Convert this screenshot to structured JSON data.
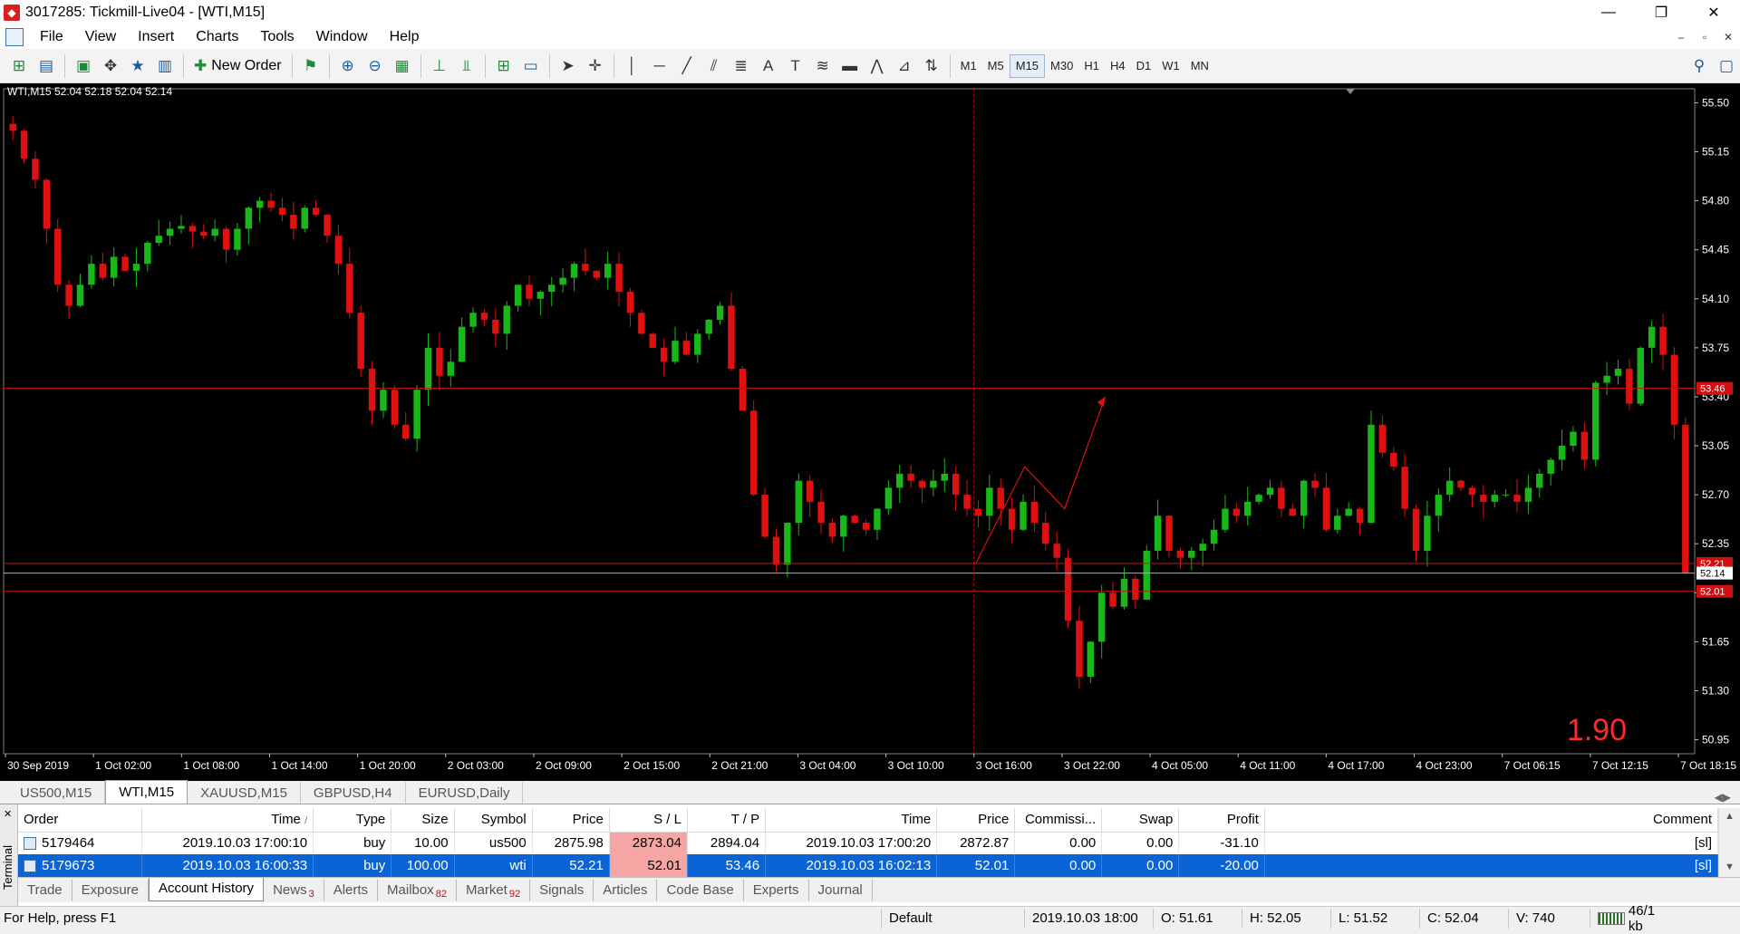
{
  "window": {
    "title": "3017285: Tickmill-Live04 - [WTI,M15]",
    "logo_glyph": "◆",
    "buttons": {
      "minimize": "—",
      "restore": "❐",
      "close": "✕"
    }
  },
  "menu": {
    "items": [
      "File",
      "View",
      "Insert",
      "Charts",
      "Tools",
      "Window",
      "Help"
    ],
    "mdi_buttons": [
      "–",
      "▫",
      "✕"
    ]
  },
  "toolbar": {
    "new_order_label": "New Order",
    "timeframes": [
      "M1",
      "M5",
      "M15",
      "M30",
      "H1",
      "H4",
      "D1",
      "W1",
      "MN"
    ],
    "active_timeframe": "M15"
  },
  "chart_data": {
    "type": "candlestick",
    "header": "WTI,M15  52.04 52.18 52.04 52.14",
    "y_ticks": [
      "55.50",
      "55.15",
      "54.80",
      "54.45",
      "54.10",
      "53.75",
      "53.40",
      "53.05",
      "52.70",
      "52.35",
      "52.00",
      "51.65",
      "51.30",
      "50.95"
    ],
    "x_ticks": [
      "30 Sep 2019",
      "1 Oct 02:00",
      "1 Oct 08:00",
      "1 Oct 14:00",
      "1 Oct 20:00",
      "2 Oct 03:00",
      "2 Oct 09:00",
      "2 Oct 15:00",
      "2 Oct 21:00",
      "3 Oct 04:00",
      "3 Oct 10:00",
      "3 Oct 16:00",
      "3 Oct 22:00",
      "4 Oct 05:00",
      "4 Oct 11:00",
      "4 Oct 17:00",
      "4 Oct 23:00",
      "7 Oct 06:15",
      "7 Oct 12:15",
      "7 Oct 18:15"
    ],
    "ylim": [
      50.85,
      55.6
    ],
    "levels": [
      {
        "label": "53.46",
        "value": 53.46,
        "color": "#d01010"
      },
      {
        "label": "52.21",
        "value": 52.21,
        "color": "#d01010"
      },
      {
        "label": "52.14",
        "value": 52.14,
        "color": "#b0b0b0"
      },
      {
        "label": "52.01",
        "value": 52.01,
        "color": "#d01010"
      }
    ],
    "close_series": [
      55.3,
      55.1,
      54.95,
      54.6,
      54.2,
      54.05,
      54.2,
      54.35,
      54.25,
      54.4,
      54.3,
      54.35,
      54.5,
      54.55,
      54.6,
      54.62,
      54.58,
      54.55,
      54.6,
      54.45,
      54.6,
      54.75,
      54.8,
      54.75,
      54.7,
      54.6,
      54.75,
      54.7,
      54.55,
      54.35,
      54.0,
      53.6,
      53.3,
      53.45,
      53.2,
      53.1,
      53.45,
      53.75,
      53.55,
      53.65,
      53.9,
      54.0,
      53.95,
      53.85,
      54.05,
      54.2,
      54.1,
      54.15,
      54.2,
      54.25,
      54.35,
      54.3,
      54.25,
      54.35,
      54.15,
      54.0,
      53.85,
      53.75,
      53.65,
      53.8,
      53.7,
      53.85,
      53.95,
      54.05,
      53.6,
      53.3,
      52.7,
      52.4,
      52.2,
      52.5,
      52.8,
      52.65,
      52.5,
      52.4,
      52.55,
      52.5,
      52.45,
      52.6,
      52.75,
      52.85,
      52.8,
      52.75,
      52.8,
      52.85,
      52.7,
      52.6,
      52.55,
      52.75,
      52.6,
      52.45,
      52.65,
      52.5,
      52.35,
      52.25,
      51.8,
      51.4,
      51.65,
      52.0,
      51.9,
      52.1,
      51.95,
      52.3,
      52.55,
      52.3,
      52.25,
      52.3,
      52.35,
      52.45,
      52.6,
      52.55,
      52.65,
      52.7,
      52.75,
      52.6,
      52.55,
      52.8,
      52.75,
      52.45,
      52.55,
      52.6,
      52.5,
      53.2,
      53.0,
      52.9,
      52.6,
      52.3,
      52.55,
      52.7,
      52.8,
      52.75,
      52.7,
      52.65,
      52.7,
      52.7,
      52.65,
      52.75,
      52.85,
      52.95,
      53.05,
      53.15,
      52.95,
      53.5,
      53.55,
      53.6,
      53.35,
      53.75,
      53.9,
      53.7,
      53.2,
      52.14
    ]
  },
  "chart_overlay": {
    "spread": "1.90"
  },
  "chart_tabs": {
    "items": [
      "US500,M15",
      "WTI,M15",
      "XAUUSD,M15",
      "GBPUSD,H4",
      "EURUSD,Daily"
    ],
    "active": "WTI,M15",
    "nav": [
      "◀",
      "▶"
    ]
  },
  "terminal": {
    "side_label": "Terminal",
    "close_glyph": "✕",
    "columns": [
      "Order",
      "Time",
      "Type",
      "Size",
      "Symbol",
      "Price",
      "S / L",
      "T / P",
      "Time",
      "Price",
      "Commissi...",
      "Swap",
      "Profit",
      "Comment"
    ],
    "sort_mark": "/",
    "rows": [
      {
        "order": "5179464",
        "open_time": "2019.10.03 17:00:10",
        "type": "buy",
        "size": "10.00",
        "symbol": "us500",
        "price": "2875.98",
        "sl": "2873.04",
        "tp": "2894.04",
        "close_time": "2019.10.03 17:00:20",
        "close_price": "2872.87",
        "commission": "0.00",
        "swap": "0.00",
        "profit": "-31.10",
        "comment": "[sl]"
      },
      {
        "order": "5179673",
        "open_time": "2019.10.03 16:00:33",
        "type": "buy",
        "size": "100.00",
        "symbol": "wti",
        "price": "52.21",
        "sl": "52.01",
        "tp": "53.46",
        "close_time": "2019.10.03 16:02:13",
        "close_price": "52.01",
        "commission": "0.00",
        "swap": "0.00",
        "profit": "-20.00",
        "comment": "[sl]"
      }
    ],
    "scroll": [
      "▲",
      "▼"
    ],
    "tabs": [
      {
        "label": "Trade",
        "badge": ""
      },
      {
        "label": "Exposure",
        "badge": ""
      },
      {
        "label": "Account History",
        "badge": ""
      },
      {
        "label": "News",
        "badge": "3"
      },
      {
        "label": "Alerts",
        "badge": ""
      },
      {
        "label": "Mailbox",
        "badge": "82"
      },
      {
        "label": "Market",
        "badge": "92"
      },
      {
        "label": "Signals",
        "badge": ""
      },
      {
        "label": "Articles",
        "badge": ""
      },
      {
        "label": "Code Base",
        "badge": ""
      },
      {
        "label": "Experts",
        "badge": ""
      },
      {
        "label": "Journal",
        "badge": ""
      }
    ],
    "active_tab": "Account History"
  },
  "status": {
    "help": "For Help, press F1",
    "profile": "Default",
    "datetime": "2019.10.03 18:00",
    "open": "O: 51.61",
    "high": "H: 52.05",
    "low": "L: 51.52",
    "close": "C: 52.04",
    "volume": "V: 740",
    "traffic": "46/1 kb"
  },
  "colors": {
    "bull": "#18b818",
    "bear": "#e01010",
    "grid_level": "#d01010",
    "selection": "#0a64d6",
    "sl_highlight": "#f6a5a5"
  }
}
